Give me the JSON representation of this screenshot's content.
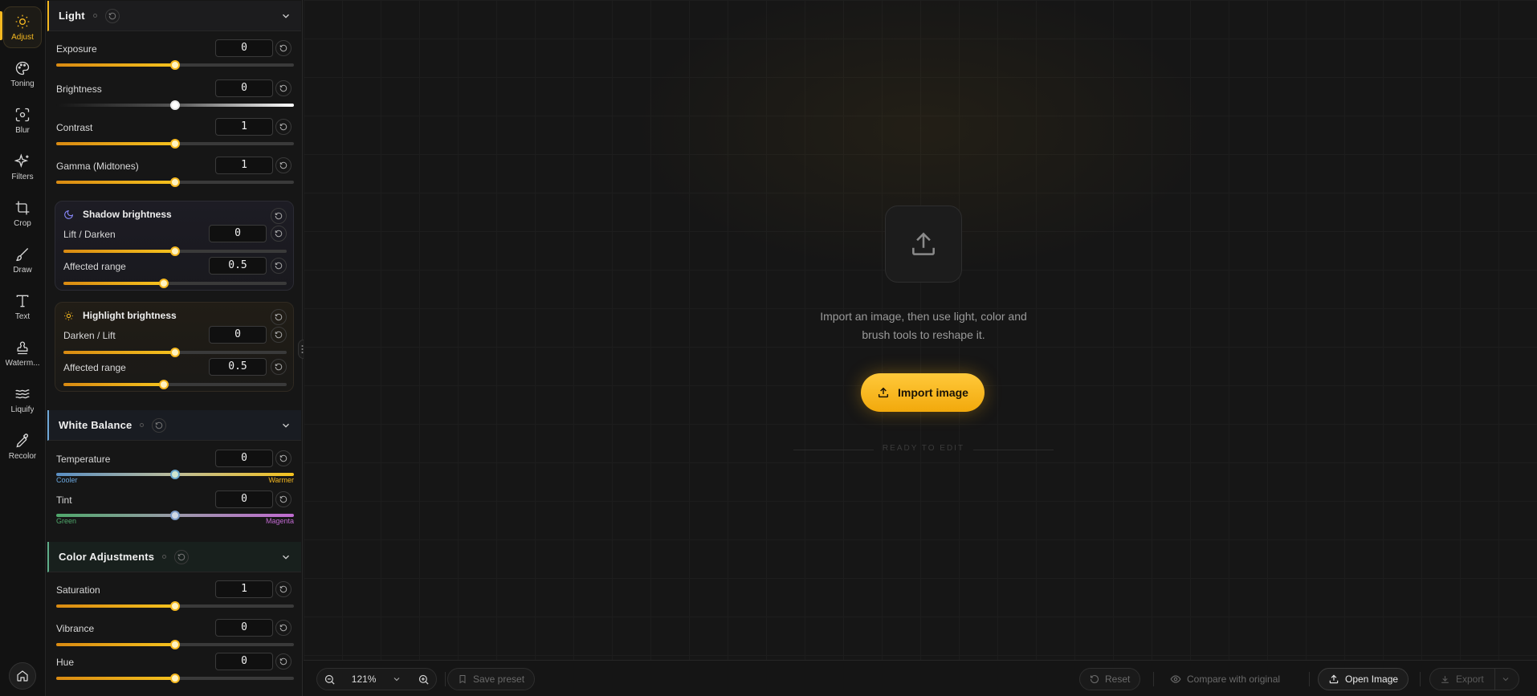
{
  "rail": {
    "items": [
      {
        "label": "Adjust",
        "icon": "sun-icon",
        "active": true
      },
      {
        "label": "Toning",
        "icon": "palette-icon"
      },
      {
        "label": "Blur",
        "icon": "focus-icon"
      },
      {
        "label": "Filters",
        "icon": "sparkle-icon"
      },
      {
        "label": "Crop",
        "icon": "crop-icon"
      },
      {
        "label": "Draw",
        "icon": "brush-icon"
      },
      {
        "label": "Text",
        "icon": "text-icon"
      },
      {
        "label": "Waterm...",
        "icon": "stamp-icon"
      },
      {
        "label": "Liquify",
        "icon": "waves-icon"
      },
      {
        "label": "Recolor",
        "icon": "eyedropper-icon"
      }
    ]
  },
  "light": {
    "title": "Light",
    "exposure": {
      "label": "Exposure",
      "value": "0",
      "fraction": 0.5
    },
    "brightness": {
      "label": "Brightness",
      "value": "0",
      "fraction": 0.5
    },
    "contrast": {
      "label": "Contrast",
      "value": "1",
      "fraction": 0.5
    },
    "gamma": {
      "label": "Gamma (Midtones)",
      "value": "1",
      "fraction": 0.5
    },
    "shadow": {
      "title": "Shadow brightness",
      "lift": {
        "label": "Lift / Darken",
        "value": "0",
        "fraction": 0.5
      },
      "range": {
        "label": "Affected range",
        "value": "0.5",
        "fraction": 0.45
      }
    },
    "highlight": {
      "title": "Highlight brightness",
      "lift": {
        "label": "Darken / Lift",
        "value": "0",
        "fraction": 0.5
      },
      "range": {
        "label": "Affected range",
        "value": "0.5",
        "fraction": 0.45
      }
    }
  },
  "white_balance": {
    "title": "White Balance",
    "temperature": {
      "label": "Temperature",
      "value": "0",
      "fraction": 0.5,
      "min_label": "Cooler",
      "max_label": "Warmer"
    },
    "tint": {
      "label": "Tint",
      "value": "0",
      "fraction": 0.5,
      "min_label": "Green",
      "max_label": "Magenta"
    }
  },
  "color_adjustments": {
    "title": "Color Adjustments",
    "saturation": {
      "label": "Saturation",
      "value": "1",
      "fraction": 0.5
    },
    "vibrance": {
      "label": "Vibrance",
      "value": "0",
      "fraction": 0.5
    },
    "hue": {
      "label": "Hue",
      "value": "0",
      "fraction": 0.5
    }
  },
  "canvas": {
    "empty_line1": "Import an image, then use light, color and",
    "empty_line2": "brush tools to reshape it.",
    "import_label": "Import image",
    "ready_label": "READY TO EDIT"
  },
  "bottom": {
    "zoom": "121%",
    "save_preset": "Save preset",
    "reset": "Reset",
    "compare": "Compare with original",
    "open_image": "Open Image",
    "export": "Export"
  },
  "colors": {
    "accent": "#f5b820",
    "background": "#141414",
    "panel": "#161616"
  }
}
